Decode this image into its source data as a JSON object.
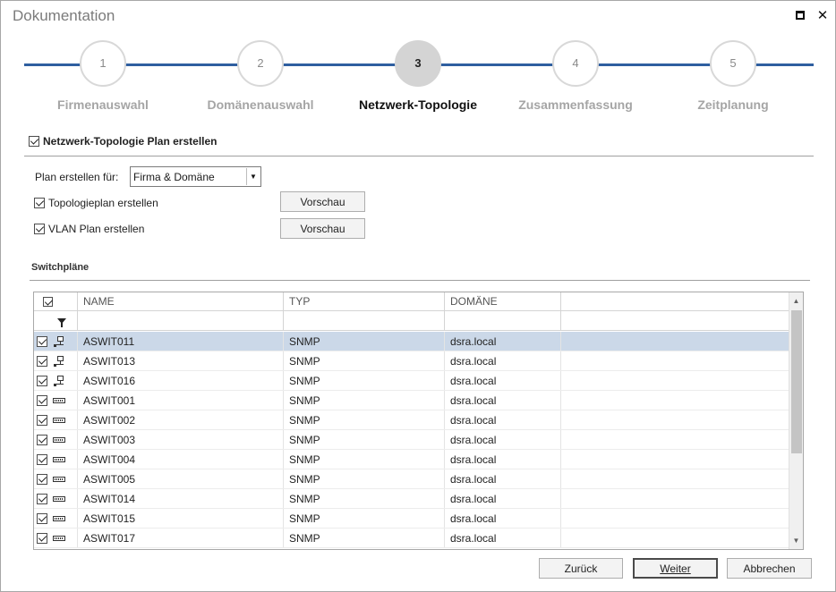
{
  "window": {
    "title": "Dokumentation",
    "maximize_icon": "maximize-icon",
    "close_glyph": "✕"
  },
  "wizard": {
    "steps": [
      {
        "number": "1",
        "label": "Firmenauswahl",
        "active": false
      },
      {
        "number": "2",
        "label": "Domänenauswahl",
        "active": false
      },
      {
        "number": "3",
        "label": "Netzwerk-Topologie",
        "active": true
      },
      {
        "number": "4",
        "label": "Zusammenfassung",
        "active": false
      },
      {
        "number": "5",
        "label": "Zeitplanung",
        "active": false
      }
    ],
    "line_color": "#2f5fa0"
  },
  "topology": {
    "create_plan_label": "Netzwerk-Topologie Plan erstellen",
    "create_plan_checked": true,
    "plan_for_label": "Plan erstellen für:",
    "plan_for_value": "Firma & Domäne",
    "topology_plan_label": "Topologieplan erstellen",
    "topology_plan_checked": true,
    "vlan_plan_label": "VLAN Plan erstellen",
    "vlan_plan_checked": true,
    "preview_label": "Vorschau"
  },
  "switchplans": {
    "heading": "Switchpläne",
    "columns": [
      "NAME",
      "TYP",
      "DOMÄNE",
      ""
    ],
    "rows": [
      {
        "name": "ASWIT011",
        "type": "SNMP",
        "domain": "dsra.local",
        "icon": "topology-icon",
        "selected": true,
        "checked": true
      },
      {
        "name": "ASWIT013",
        "type": "SNMP",
        "domain": "dsra.local",
        "icon": "topology-icon",
        "selected": false,
        "checked": true
      },
      {
        "name": "ASWIT016",
        "type": "SNMP",
        "domain": "dsra.local",
        "icon": "topology-icon",
        "selected": false,
        "checked": true
      },
      {
        "name": "ASWIT001",
        "type": "SNMP",
        "domain": "dsra.local",
        "icon": "switch-icon",
        "selected": false,
        "checked": true
      },
      {
        "name": "ASWIT002",
        "type": "SNMP",
        "domain": "dsra.local",
        "icon": "switch-icon",
        "selected": false,
        "checked": true
      },
      {
        "name": "ASWIT003",
        "type": "SNMP",
        "domain": "dsra.local",
        "icon": "switch-icon",
        "selected": false,
        "checked": true
      },
      {
        "name": "ASWIT004",
        "type": "SNMP",
        "domain": "dsra.local",
        "icon": "switch-icon",
        "selected": false,
        "checked": true
      },
      {
        "name": "ASWIT005",
        "type": "SNMP",
        "domain": "dsra.local",
        "icon": "switch-icon",
        "selected": false,
        "checked": true
      },
      {
        "name": "ASWIT014",
        "type": "SNMP",
        "domain": "dsra.local",
        "icon": "switch-icon",
        "selected": false,
        "checked": true
      },
      {
        "name": "ASWIT015",
        "type": "SNMP",
        "domain": "dsra.local",
        "icon": "switch-icon",
        "selected": false,
        "checked": true
      },
      {
        "name": "ASWIT017",
        "type": "SNMP",
        "domain": "dsra.local",
        "icon": "switch-icon",
        "selected": false,
        "checked": true
      }
    ],
    "selected_color": "#cbd8e8"
  },
  "footer": {
    "back_label": "Zurück",
    "next_label": "Weiter",
    "cancel_label": "Abbrechen"
  }
}
